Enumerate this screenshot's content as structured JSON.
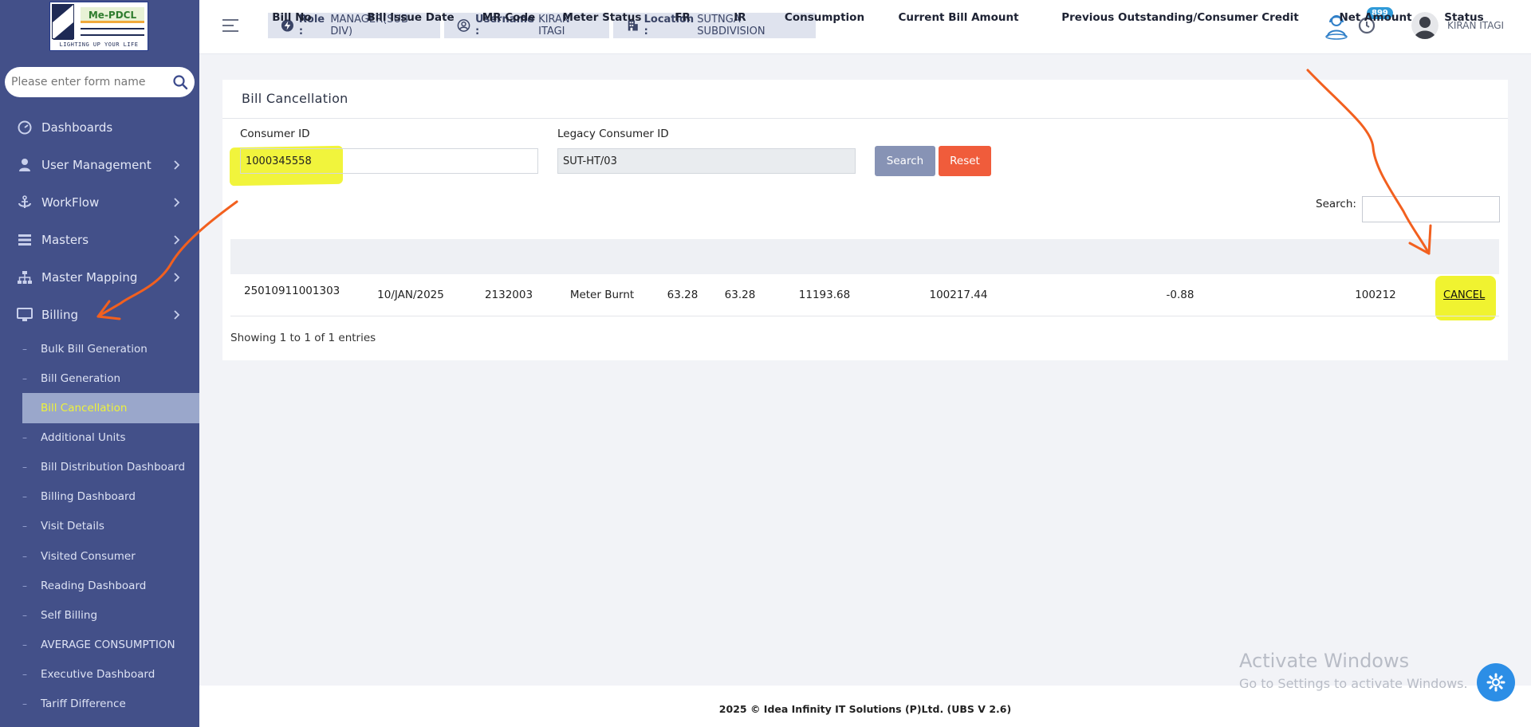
{
  "brand": {
    "logo_name": "Me-PDCL",
    "logo_tagline": "LIGHTING UP YOUR LIFE"
  },
  "sidebar": {
    "search_placeholder": "Please enter form name",
    "nav": [
      {
        "label": "Dashboards",
        "icon": "dashboard-icon",
        "has_children": false
      },
      {
        "label": "User Management",
        "icon": "user-icon",
        "has_children": true
      },
      {
        "label": "WorkFlow",
        "icon": "anchor-icon",
        "has_children": true
      },
      {
        "label": "Masters",
        "icon": "list-icon",
        "has_children": true
      },
      {
        "label": "Master Mapping",
        "icon": "sitemap-icon",
        "has_children": true
      },
      {
        "label": "Billing",
        "icon": "monitor-icon",
        "has_children": true
      }
    ],
    "billing_subitems": [
      "Bulk Bill Generation",
      "Bill Generation",
      "Bill Cancellation",
      "Additional Units",
      "Bill Distribution Dashboard",
      "Billing Dashboard",
      "Visit Details",
      "Visited Consumer",
      "Reading Dashboard",
      "Self Billing",
      "AVERAGE CONSUMPTION",
      "Executive Dashboard",
      "Tariff Difference"
    ],
    "active_subitem": "Bill Cancellation"
  },
  "topbar": {
    "role_key": "Role :",
    "role_value": "MANAGER(SUB DIV)",
    "username_key": "Username :",
    "username_value": "KIRAN ITAGI",
    "location_key": "Location :",
    "location_value": "SUTNGA SUBDIVISION",
    "notification_count": "899",
    "user_display": "KIRAN ITAGI"
  },
  "page": {
    "title": "Bill Cancellation",
    "consumer_id_label": "Consumer ID",
    "consumer_id_value": "1000345558",
    "legacy_id_label": "Legacy Consumer ID",
    "legacy_id_value": "SUT-HT/03",
    "search_button": "Search",
    "reset_button": "Reset",
    "table_search_label": "Search:"
  },
  "table": {
    "columns": [
      "Bill No",
      "Bill Issue Date",
      "MR Code",
      "Meter Status",
      "FR",
      "IR",
      "Consumption",
      "Current Bill Amount",
      "Previous Outstanding/Consumer Credit",
      "Net Amount",
      "Status"
    ],
    "rows": [
      {
        "bill_no": "25010911001303",
        "issue_date": "10/JAN/2025",
        "mr_code": "2132003",
        "meter_status": "Meter Burnt",
        "fr": "63.28",
        "ir": "63.28",
        "consumption": "11193.68",
        "current_bill": "100217.44",
        "previous_outstanding": "-0.88",
        "net_amount": "100212",
        "status_action": "CANCEL"
      }
    ],
    "info": "Showing 1 to 1 of 1 entries"
  },
  "footer": {
    "text": "2025 © Idea Infinity IT Solutions (P)Ltd. (UBS V 2.6)"
  },
  "watermark": {
    "title": "Activate Windows",
    "subtitle": "Go to Settings to activate Windows."
  },
  "colors": {
    "sidebar_bg": "#435089",
    "active_bg": "#9aa7cb",
    "highlight": "#eef21a",
    "annotation_arrow": "#f2601f",
    "search_btn": "#8793b5",
    "reset_btn": "#f05c3b",
    "fab": "#2c8ee6"
  }
}
